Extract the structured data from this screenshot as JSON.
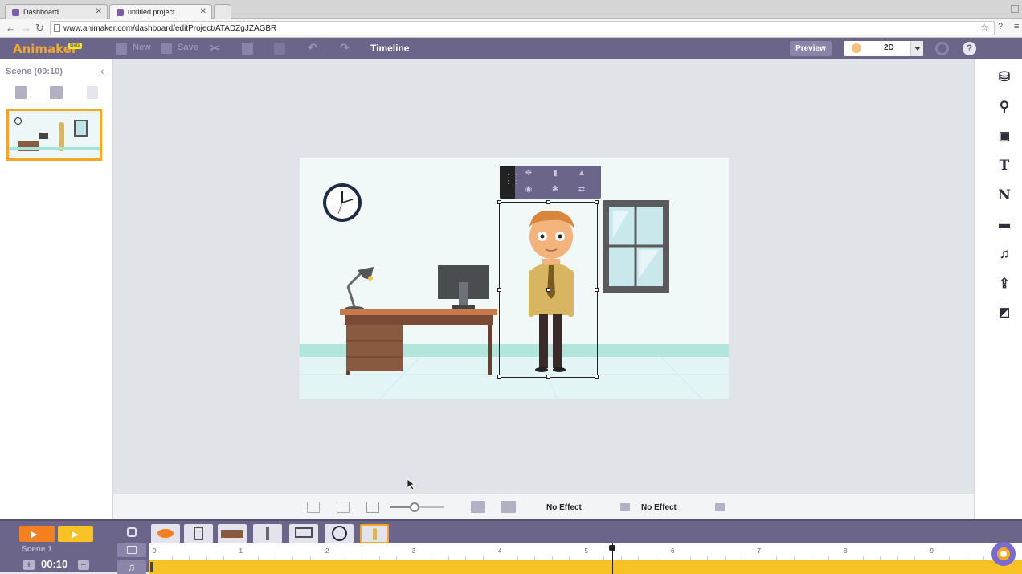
{
  "browser": {
    "tabs": [
      {
        "title": "Dashboard",
        "active": false
      },
      {
        "title": "untitled project",
        "active": true
      }
    ],
    "url": "www.animaker.com/dashboard/editProject/ATADZgJZAGBR"
  },
  "toolbar": {
    "logo": "Animaker",
    "beta_badge": "Beta",
    "new_label": "New",
    "save_label": "Save",
    "timeline_label": "Timeline",
    "preview_label": "Preview",
    "mode_value": "2D"
  },
  "scene_panel": {
    "title": "Scene (00:10)"
  },
  "effects_bar": {
    "enter_effect": "No Effect",
    "exit_effect": "No Effect",
    "zoom_level": 0.45
  },
  "timeline": {
    "scene_name": "Scene 1",
    "duration": "00:10",
    "ruler_ticks": [
      "0",
      "1",
      "2",
      "3",
      "4",
      "5",
      "6",
      "7",
      "8",
      "9"
    ],
    "playhead_seconds": 5.3
  },
  "colors": {
    "toolbar_bg": "#6b6589",
    "accent_orange": "#f5a623",
    "track_yellow": "#f8c224",
    "workspace_bg": "#e0e3e8"
  },
  "right_panel_icons": [
    "character-icon",
    "props-icon",
    "image-icon",
    "text-icon",
    "number-icon",
    "video-icon",
    "music-icon",
    "upload-icon",
    "background-icon"
  ]
}
